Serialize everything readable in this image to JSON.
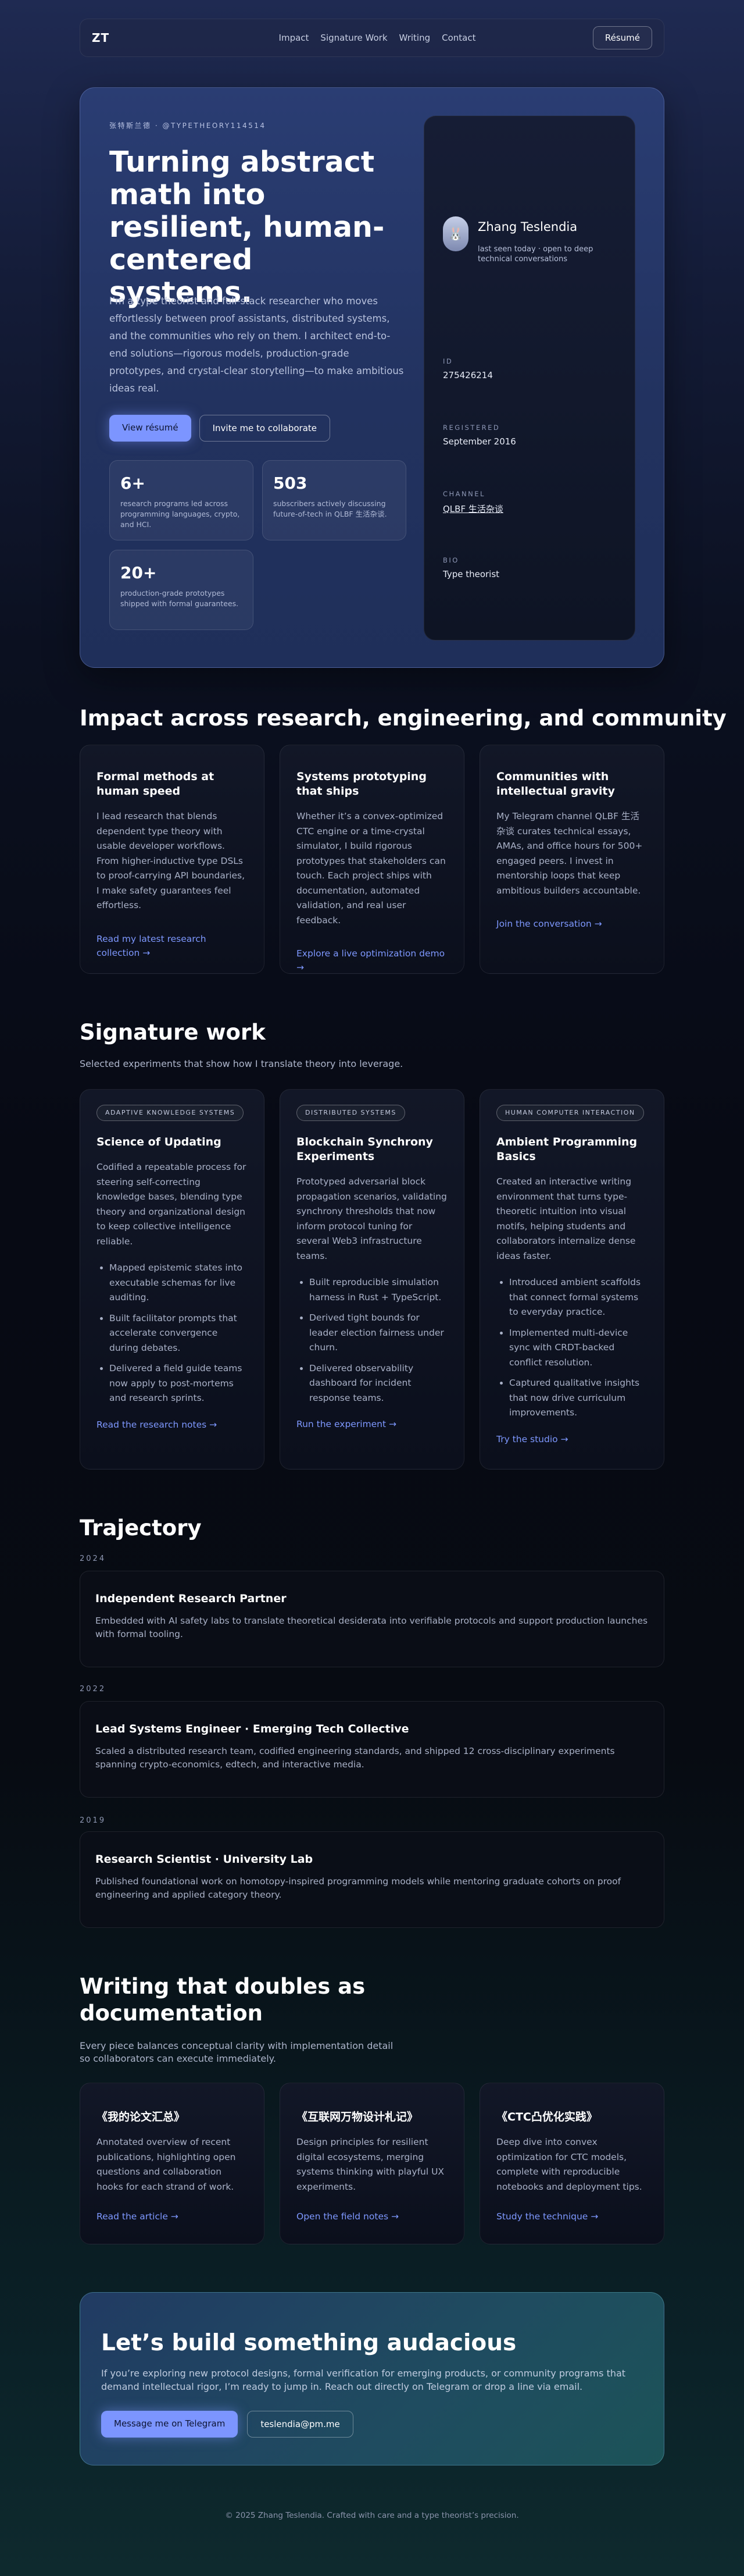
{
  "nav": {
    "logo": "ZT",
    "links": [
      "Impact",
      "Signature Work",
      "Writing",
      "Contact"
    ],
    "resume": "Résumé"
  },
  "hero": {
    "eyebrow": "张特斯兰德 · @TYPETHEORY114514",
    "title": "Turning abstract math into resilient, human-centered systems.",
    "description": "I’m a type theorist and full-stack researcher who moves effortlessly between proof assistants, distributed systems, and the communities who rely on them. I architect end-to-end solutions—rigorous models, production-grade prototypes, and crystal-clear storytelling—to make ambitious ideas real.",
    "primary_btn": "View résumé",
    "secondary_btn": "Invite me to collaborate",
    "stats": [
      {
        "value": "6+",
        "text": "research programs led across programming languages, crypto, and HCI."
      },
      {
        "value": "503",
        "text": "subscribers actively discussing future-of-tech in QLBF 生活杂谈."
      },
      {
        "value": "20+",
        "text": "production-grade prototypes shipped with formal guarantees."
      }
    ]
  },
  "profile": {
    "avatar_icon": "rabbit-icon",
    "name": "Zhang Teslendia",
    "status": "last seen today · open to deep technical conversations",
    "id_label": "ID",
    "id_value": "275426214",
    "registered_label": "REGISTERED",
    "registered_value": "September 2016",
    "channel_label": "CHANNEL",
    "channel_value": "QLBF 生活杂谈",
    "bio_label": "BIO",
    "bio_value": "Type theorist"
  },
  "impact": {
    "title": "Impact across research, engineering, and community",
    "cards": [
      {
        "title": "Formal methods at human speed",
        "text": "I lead research that blends dependent type theory with usable developer workflows. From higher-inductive type DSLs to proof-carrying API boundaries, I make safety guarantees feel effortless.",
        "link": "Read my latest research collection →"
      },
      {
        "title": "Systems prototyping that ships",
        "text": "Whether it’s a convex-optimized CTC engine or a time-crystal simulator, I build rigorous prototypes that stakeholders can touch. Each project ships with documentation, automated validation, and real user feedback.",
        "link": "Explore a live optimization demo →"
      },
      {
        "title": "Communities with intellectual gravity",
        "text": "My Telegram channel QLBF 生活杂谈 curates technical essays, AMAs, and office hours for 500+ engaged peers. I invest in mentorship loops that keep ambitious builders accountable.",
        "link": "Join the conversation →"
      }
    ]
  },
  "work": {
    "title": "Signature work",
    "subtitle": "Selected experiments that show how I translate theory into leverage.",
    "cards": [
      {
        "tag": "ADAPTIVE KNOWLEDGE SYSTEMS",
        "title": "Science of Updating",
        "text": "Codified a repeatable process for steering self-correcting knowledge bases, blending type theory and organizational design to keep collective intelligence reliable.",
        "bullets": [
          "Mapped epistemic states into executable schemas for live auditing.",
          "Built facilitator prompts that accelerate convergence during debates.",
          "Delivered a field guide teams now apply to post-mortems and research sprints."
        ],
        "link": "Read the research notes →"
      },
      {
        "tag": "DISTRIBUTED SYSTEMS",
        "title": "Blockchain Synchrony Experiments",
        "text": "Prototyped adversarial block propagation scenarios, validating synchrony thresholds that now inform protocol tuning for several Web3 infrastructure teams.",
        "bullets": [
          "Built reproducible simulation harness in Rust + TypeScript.",
          "Derived tight bounds for leader election fairness under churn.",
          "Delivered observability dashboard for incident response teams."
        ],
        "link": "Run the experiment →"
      },
      {
        "tag": "HUMAN COMPUTER INTERACTION",
        "title": "Ambient Programming Basics",
        "text": "Created an interactive writing environment that turns type-theoretic intuition into visual motifs, helping students and collaborators internalize dense ideas faster.",
        "bullets": [
          "Introduced ambient scaffolds that connect formal systems to everyday practice.",
          "Implemented multi-device sync with CRDT-backed conflict resolution.",
          "Captured qualitative insights that now drive curriculum improvements."
        ],
        "link": "Try the studio →"
      }
    ]
  },
  "trajectory": {
    "title": "Trajectory",
    "items": [
      {
        "year": "2024",
        "title": "Independent Research Partner",
        "text": "Embedded with AI safety labs to translate theoretical desiderata into verifiable protocols and support production launches with formal tooling."
      },
      {
        "year": "2022",
        "title": "Lead Systems Engineer · Emerging Tech Collective",
        "text": "Scaled a distributed research team, codified engineering standards, and shipped 12 cross-disciplinary experiments spanning crypto-economics, edtech, and interactive media."
      },
      {
        "year": "2019",
        "title": "Research Scientist · University Lab",
        "text": "Published foundational work on homotopy-inspired programming models while mentoring graduate cohorts on proof engineering and applied category theory."
      }
    ]
  },
  "writing": {
    "title": "Writing that doubles as documentation",
    "subtitle": "Every piece balances conceptual clarity with implementation detail so collaborators can execute immediately.",
    "cards": [
      {
        "title": "《我的论文汇总》",
        "text": "Annotated overview of recent publications, highlighting open questions and collaboration hooks for each strand of work.",
        "link": "Read the article →"
      },
      {
        "title": "《互联网万物设计札记》",
        "text": "Design principles for resilient digital ecosystems, merging systems thinking with playful UX experiments.",
        "link": "Open the field notes →"
      },
      {
        "title": "《CTC凸优化实践》",
        "text": "Deep dive into convex optimization for CTC models, complete with reproducible notebooks and deployment tips.",
        "link": "Study the technique →"
      }
    ]
  },
  "cta": {
    "title": "Let’s build something audacious",
    "text": "If you’re exploring new protocol designs, formal verification for emerging products, or community programs that demand intellectual rigor, I’m ready to jump in. Reach out directly on Telegram or drop a line via email.",
    "primary": "Message me on Telegram",
    "secondary": "teslendia@pm.me"
  },
  "footer": "© 2025 Zhang Teslendia. Crafted with care and a type theorist’s precision.",
  "colors": {
    "accent": "#7c95ff",
    "link": "#7e98ff"
  }
}
